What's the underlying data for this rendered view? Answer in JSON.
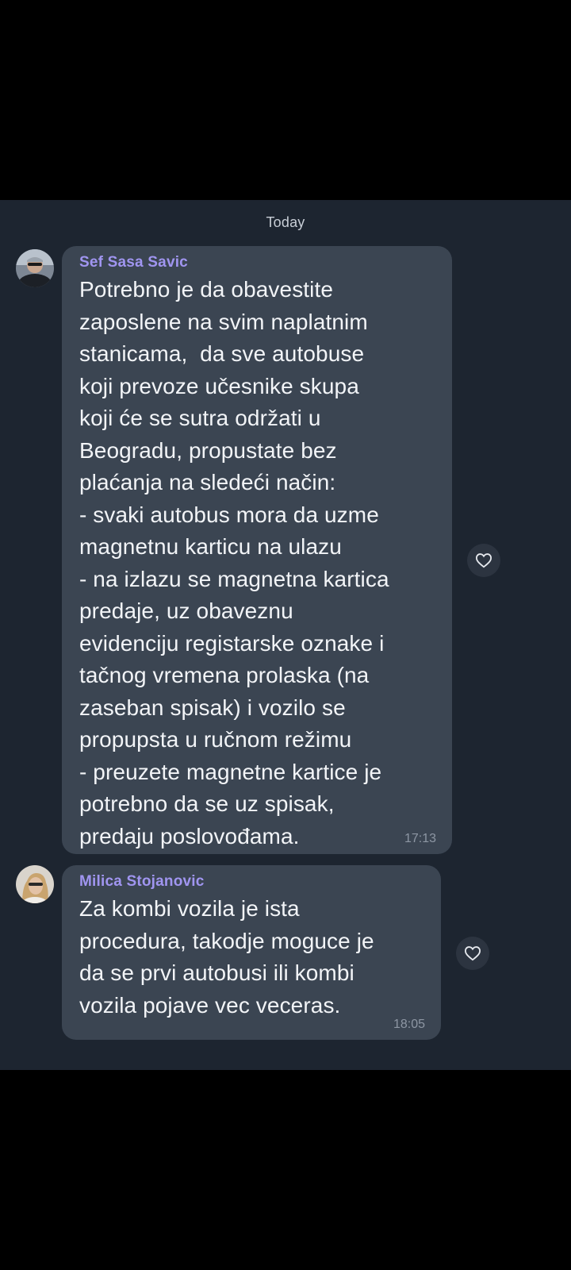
{
  "date_separator": "Today",
  "messages": [
    {
      "sender": "Sef Sasa Savic",
      "avatar_icon": "avatar-man-photo",
      "lines": [
        "Potrebno je da obavestite",
        "zaposlene na svim naplatnim",
        "stanicama,  da sve autobuse",
        "koji prevoze učesnike skupa",
        "koji će se sutra održati u",
        "Beogradu, propustate bez",
        "plaćanja na sledeći način:",
        "- svaki autobus mora da uzme",
        "magnetnu karticu na ulazu",
        "- na izlazu se magnetna kartica",
        "predaje, uz obaveznu",
        "evidenciju registarske oznake i",
        "tačnog vremena prolaska (na",
        "zaseban spisak) i vozilo se",
        "propupsta u ručnom režimu",
        "- preuzete magnetne kartice je",
        "potrebno da se uz spisak,",
        "predaju poslovođama."
      ],
      "time": "17:13",
      "reaction_icon": "heart-icon"
    },
    {
      "sender": "Milica Stojanovic",
      "avatar_icon": "avatar-woman-photo",
      "lines": [
        "Za kombi vozila je ista",
        "procedura, takodje moguce je",
        "da se prvi autobusi ili kombi",
        "vozila pojave vec veceras."
      ],
      "time": "18:05",
      "reaction_icon": "heart-icon"
    }
  ],
  "colors": {
    "chat_background": "#1d2530",
    "bubble": "#3b4552",
    "sender_name": "#a095f0",
    "message_text": "#f2f4f7",
    "timestamp": "#8d96a3"
  }
}
